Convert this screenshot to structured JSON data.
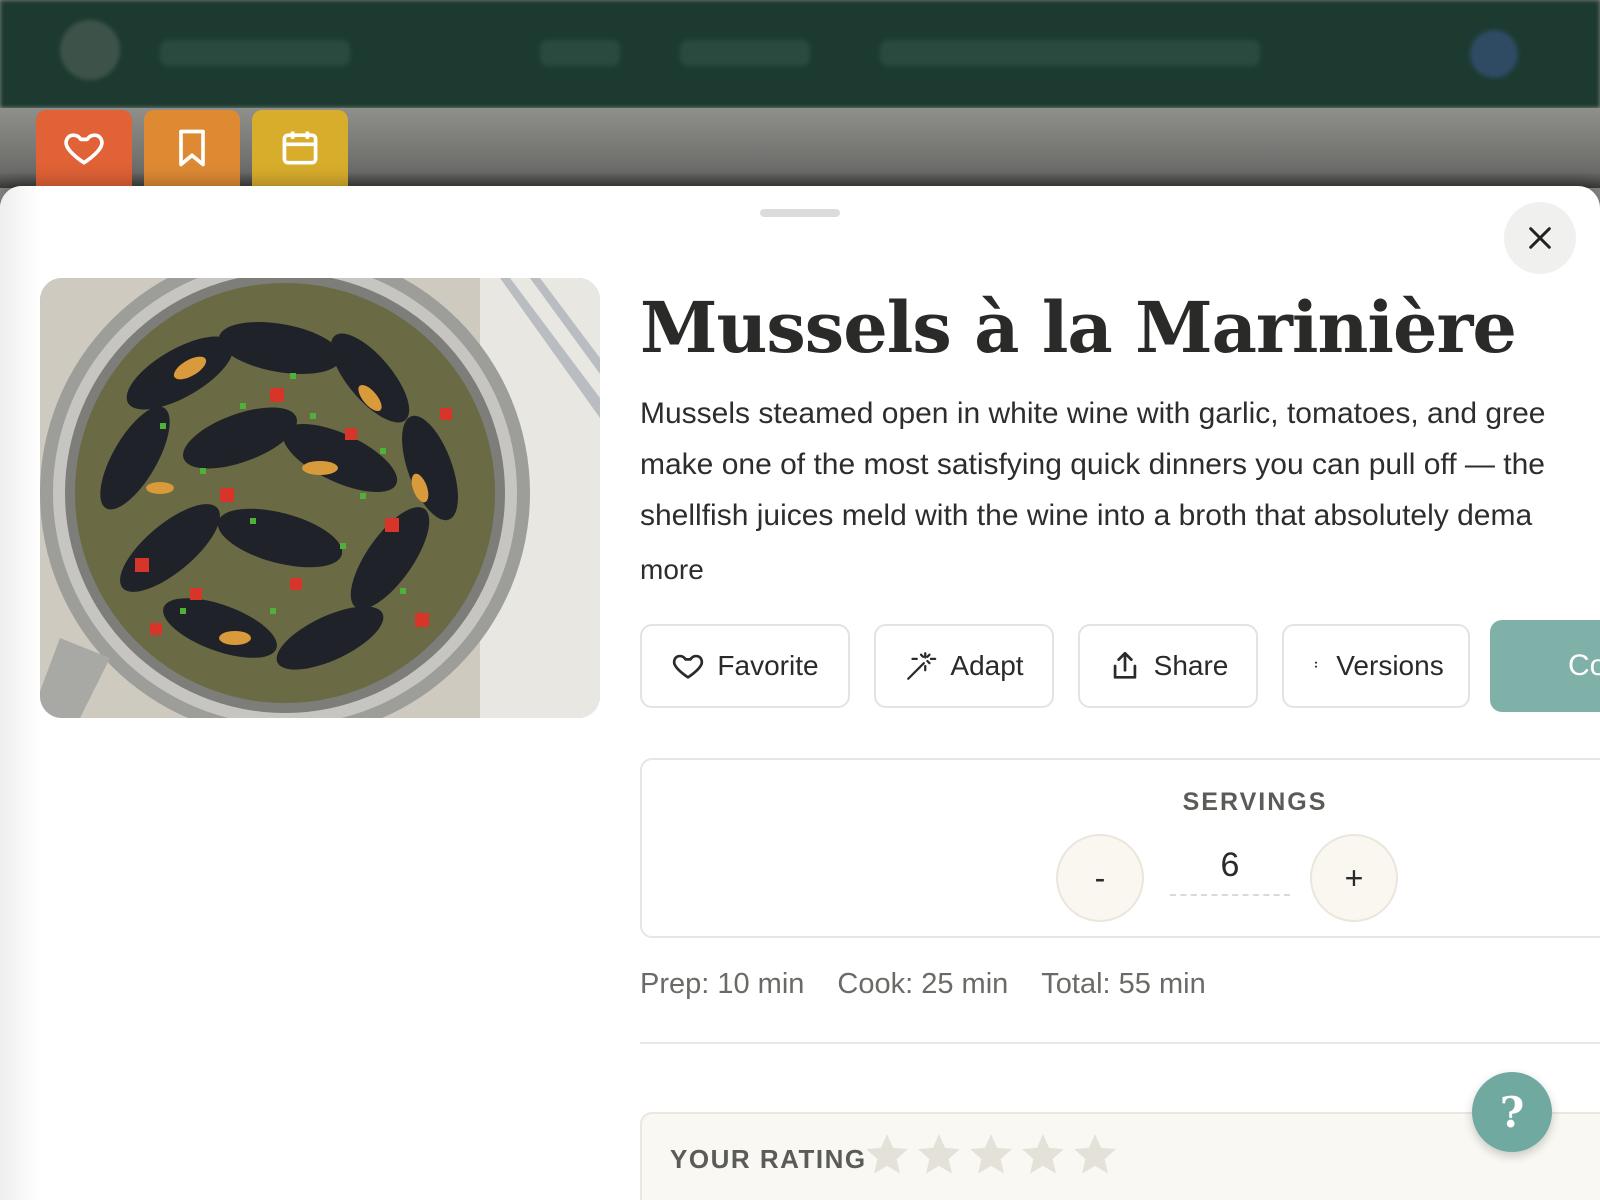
{
  "recipe": {
    "title": "Mussels à la Marinière",
    "description_lines": [
      "Mussels steamed open in white wine with garlic, tomatoes, and gree",
      "make one of the most satisfying quick dinners you can pull off — the",
      "shellfish juices meld with the wine into a broth that absolutely dema"
    ],
    "more_label": "more",
    "image_alt": "Pot of steamed mussels with tomatoes and chives"
  },
  "tabs": [
    {
      "icon": "heart-icon"
    },
    {
      "icon": "bookmark-icon"
    },
    {
      "icon": "calendar-icon"
    }
  ],
  "actions": {
    "favorite": "Favorite",
    "adapt": "Adapt",
    "share": "Share",
    "versions": "Versions",
    "cook": "Co"
  },
  "servings": {
    "label": "SERVINGS",
    "value": "6",
    "minus": "-",
    "plus": "+"
  },
  "times": {
    "prep": "Prep: 10 min",
    "cook": "Cook: 25 min",
    "total": "Total: 55 min"
  },
  "rating": {
    "label": "YOUR RATING",
    "value": 0,
    "max": 5
  },
  "help": {
    "label": "?"
  },
  "colors": {
    "tab_favorite": "#e06236",
    "tab_save": "#dd8a33",
    "tab_plan": "#d8ad2c",
    "accent_teal": "#7fb1a8",
    "header_bg": "#1c3a30"
  }
}
